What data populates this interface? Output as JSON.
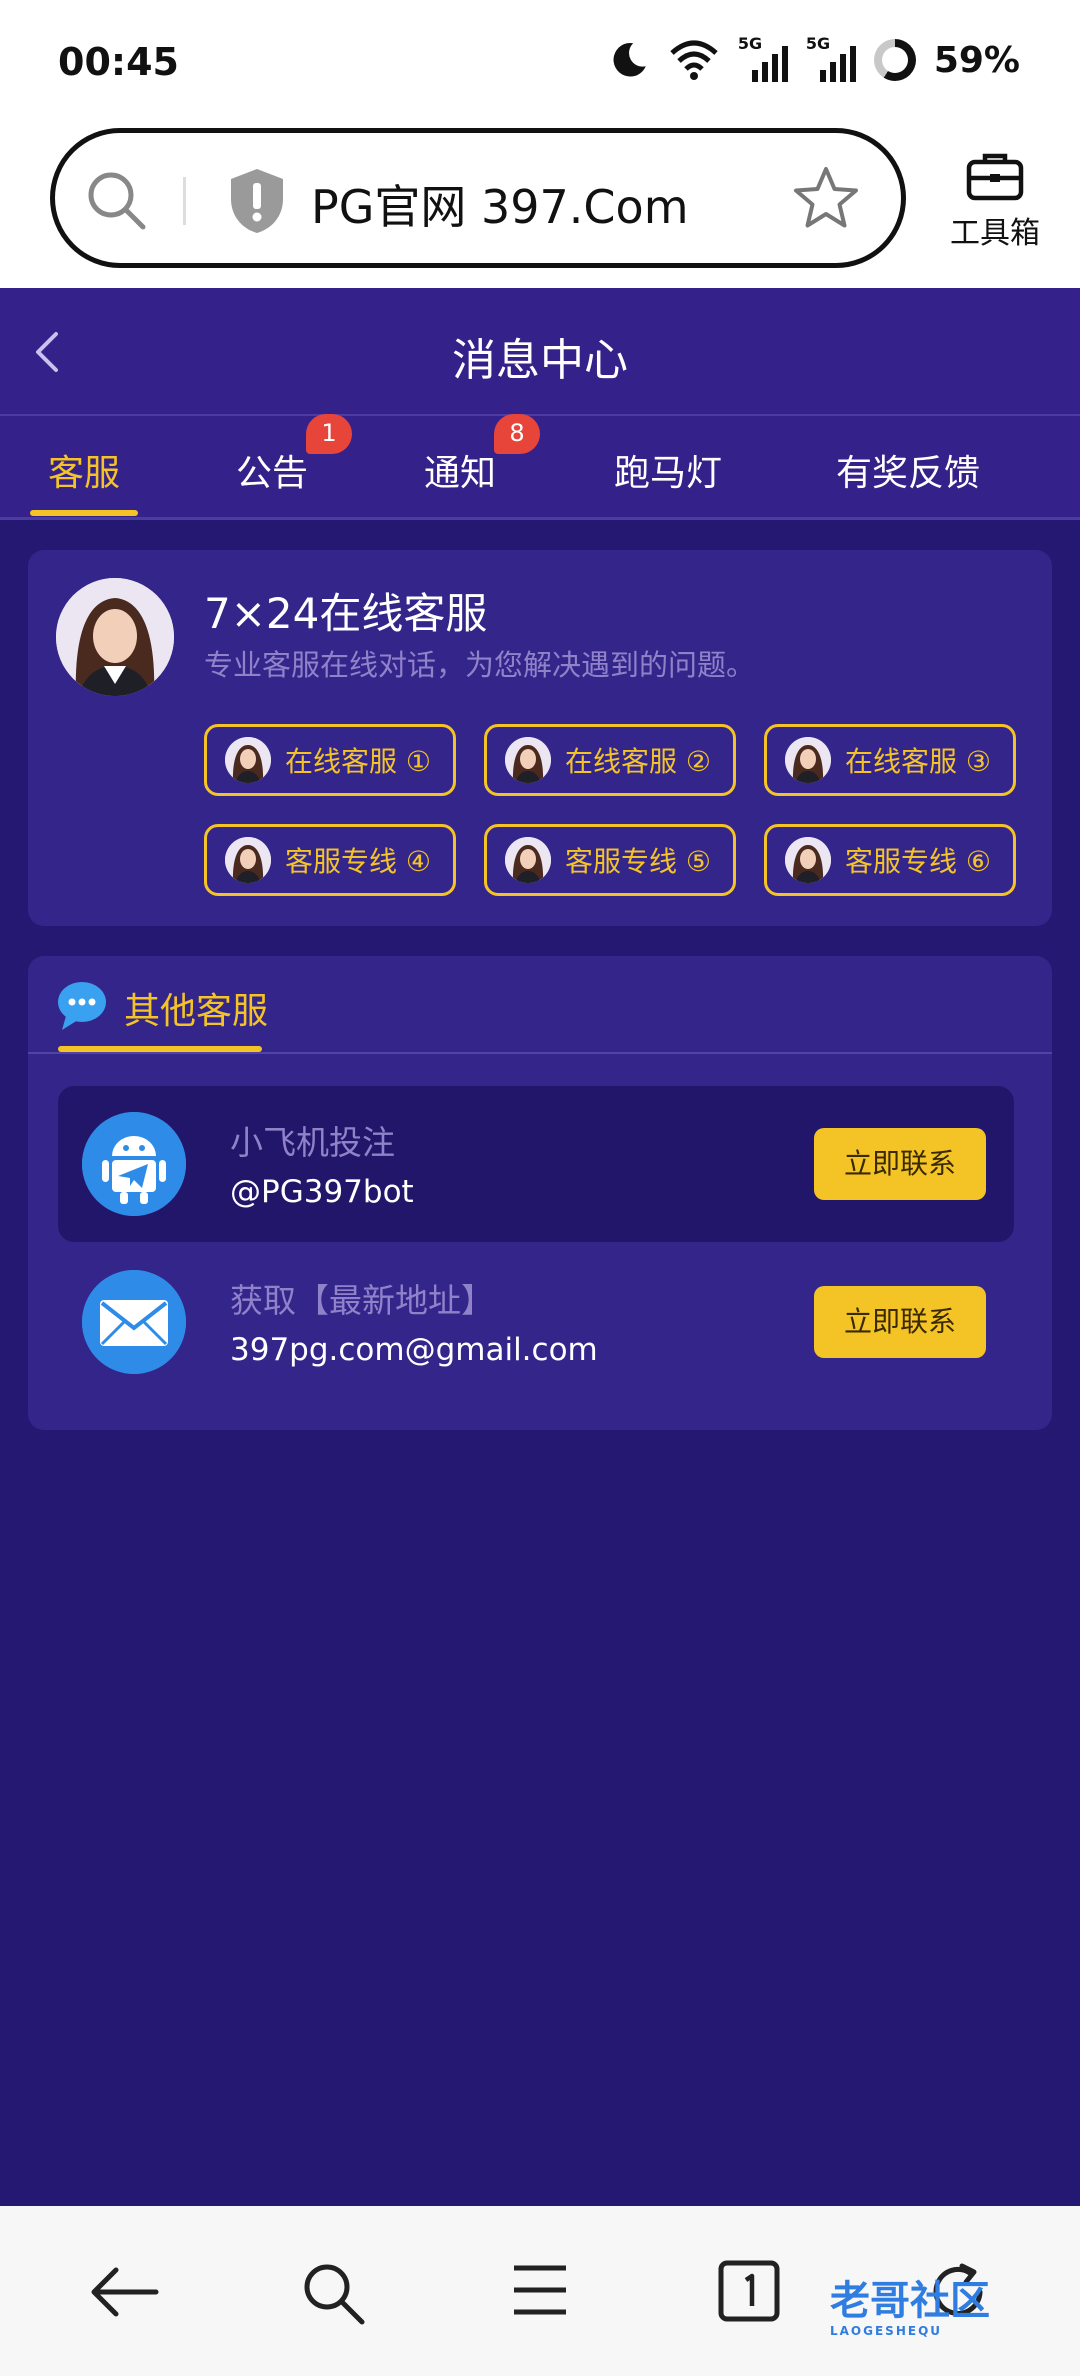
{
  "status": {
    "time": "00:45",
    "net1": "5G",
    "net2": "5G",
    "battery": "59%"
  },
  "browser": {
    "url": "PG官网 397.Com",
    "toolbox_label": "工具箱"
  },
  "header": {
    "title": "消息中心"
  },
  "tabs": [
    {
      "label": "客服",
      "active": true
    },
    {
      "label": "公告",
      "badge": "1"
    },
    {
      "label": "通知",
      "badge": "8"
    },
    {
      "label": "跑马灯"
    },
    {
      "label": "有奖反馈"
    }
  ],
  "support": {
    "title": "7×24在线客服",
    "subtitle": "专业客服在线对话，为您解决遇到的问题。",
    "chips": [
      "在线客服 ①",
      "在线客服 ②",
      "在线客服 ③",
      "客服专线 ④",
      "客服专线 ⑤",
      "客服专线 ⑥"
    ]
  },
  "other": {
    "title": "其他客服",
    "items": [
      {
        "name": "小飞机投注",
        "value": "@PG397bot",
        "action": "立即联系"
      },
      {
        "name": "获取【最新地址】",
        "value": "397pg.com@gmail.com",
        "action": "立即联系"
      }
    ]
  },
  "colors": {
    "accent": "#f4c326",
    "background": "#251873",
    "card": "#34258a",
    "badge": "#e8453a"
  },
  "watermark": {
    "text": "老哥社区",
    "sub": "LAOGESHEQU"
  }
}
